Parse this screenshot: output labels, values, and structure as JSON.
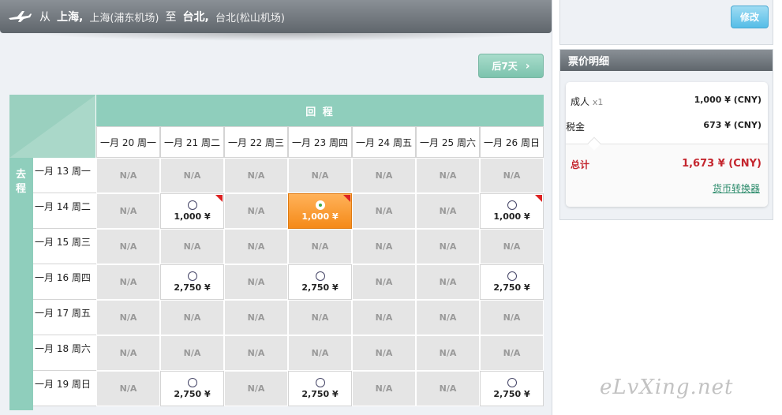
{
  "header": {
    "from_word": "从",
    "origin_city": "上海,",
    "origin_airport": "上海(浦东机场)",
    "to_word": "至",
    "dest_city": "台北,",
    "dest_airport": "台北(松山机场)"
  },
  "nav": {
    "next7_label": "后7天",
    "next7_chevron": "›"
  },
  "grid": {
    "return_title": "回 程",
    "depart_title": [
      "去",
      "程"
    ],
    "columns": [
      "一月 20 周一",
      "一月 21 周二",
      "一月 22 周三",
      "一月 23 周四",
      "一月 24 周五",
      "一月 25 周六",
      "一月 26 周日"
    ],
    "rows": [
      {
        "label": "一月 13 周一",
        "cells": [
          "N/A",
          "N/A",
          "N/A",
          "N/A",
          "N/A",
          "N/A",
          "N/A"
        ]
      },
      {
        "label": "一月 14 周二",
        "cells": [
          "N/A",
          "1,000 ¥",
          "N/A",
          "1,000 ¥",
          "N/A",
          "N/A",
          "1,000 ¥"
        ]
      },
      {
        "label": "一月 15 周三",
        "cells": [
          "N/A",
          "N/A",
          "N/A",
          "N/A",
          "N/A",
          "N/A",
          "N/A"
        ]
      },
      {
        "label": "一月 16 周四",
        "cells": [
          "N/A",
          "2,750 ¥",
          "N/A",
          "2,750 ¥",
          "N/A",
          "N/A",
          "2,750 ¥"
        ]
      },
      {
        "label": "一月 17 周五",
        "cells": [
          "N/A",
          "N/A",
          "N/A",
          "N/A",
          "N/A",
          "N/A",
          "N/A"
        ]
      },
      {
        "label": "一月 18 周六",
        "cells": [
          "N/A",
          "N/A",
          "N/A",
          "N/A",
          "N/A",
          "N/A",
          "N/A"
        ]
      },
      {
        "label": "一月 19 周日",
        "cells": [
          "N/A",
          "2,750 ¥",
          "N/A",
          "2,750 ¥",
          "N/A",
          "N/A",
          "2,750 ¥"
        ]
      }
    ],
    "selected": {
      "row": 1,
      "col": 3
    },
    "flagged": [
      [
        1,
        1
      ],
      [
        1,
        3
      ],
      [
        1,
        6
      ]
    ]
  },
  "sidebar": {
    "modify_label": "修改",
    "price_title": "票价明细",
    "adult_label": "成人",
    "adult_qty": "x1",
    "adult_amount": "1,000 ¥ (CNY)",
    "tax_label": "税金",
    "tax_amount": "673 ¥ (CNY)",
    "total_label": "总计",
    "total_amount": "1,673 ¥ (CNY)",
    "converter_label": "货币转换器"
  },
  "watermark": "eLvXing.net",
  "colors": {
    "accent_green": "#8fcebc",
    "selected_orange": "#f58a18",
    "total_red": "#c4262e",
    "button_blue": "#55bde7"
  }
}
